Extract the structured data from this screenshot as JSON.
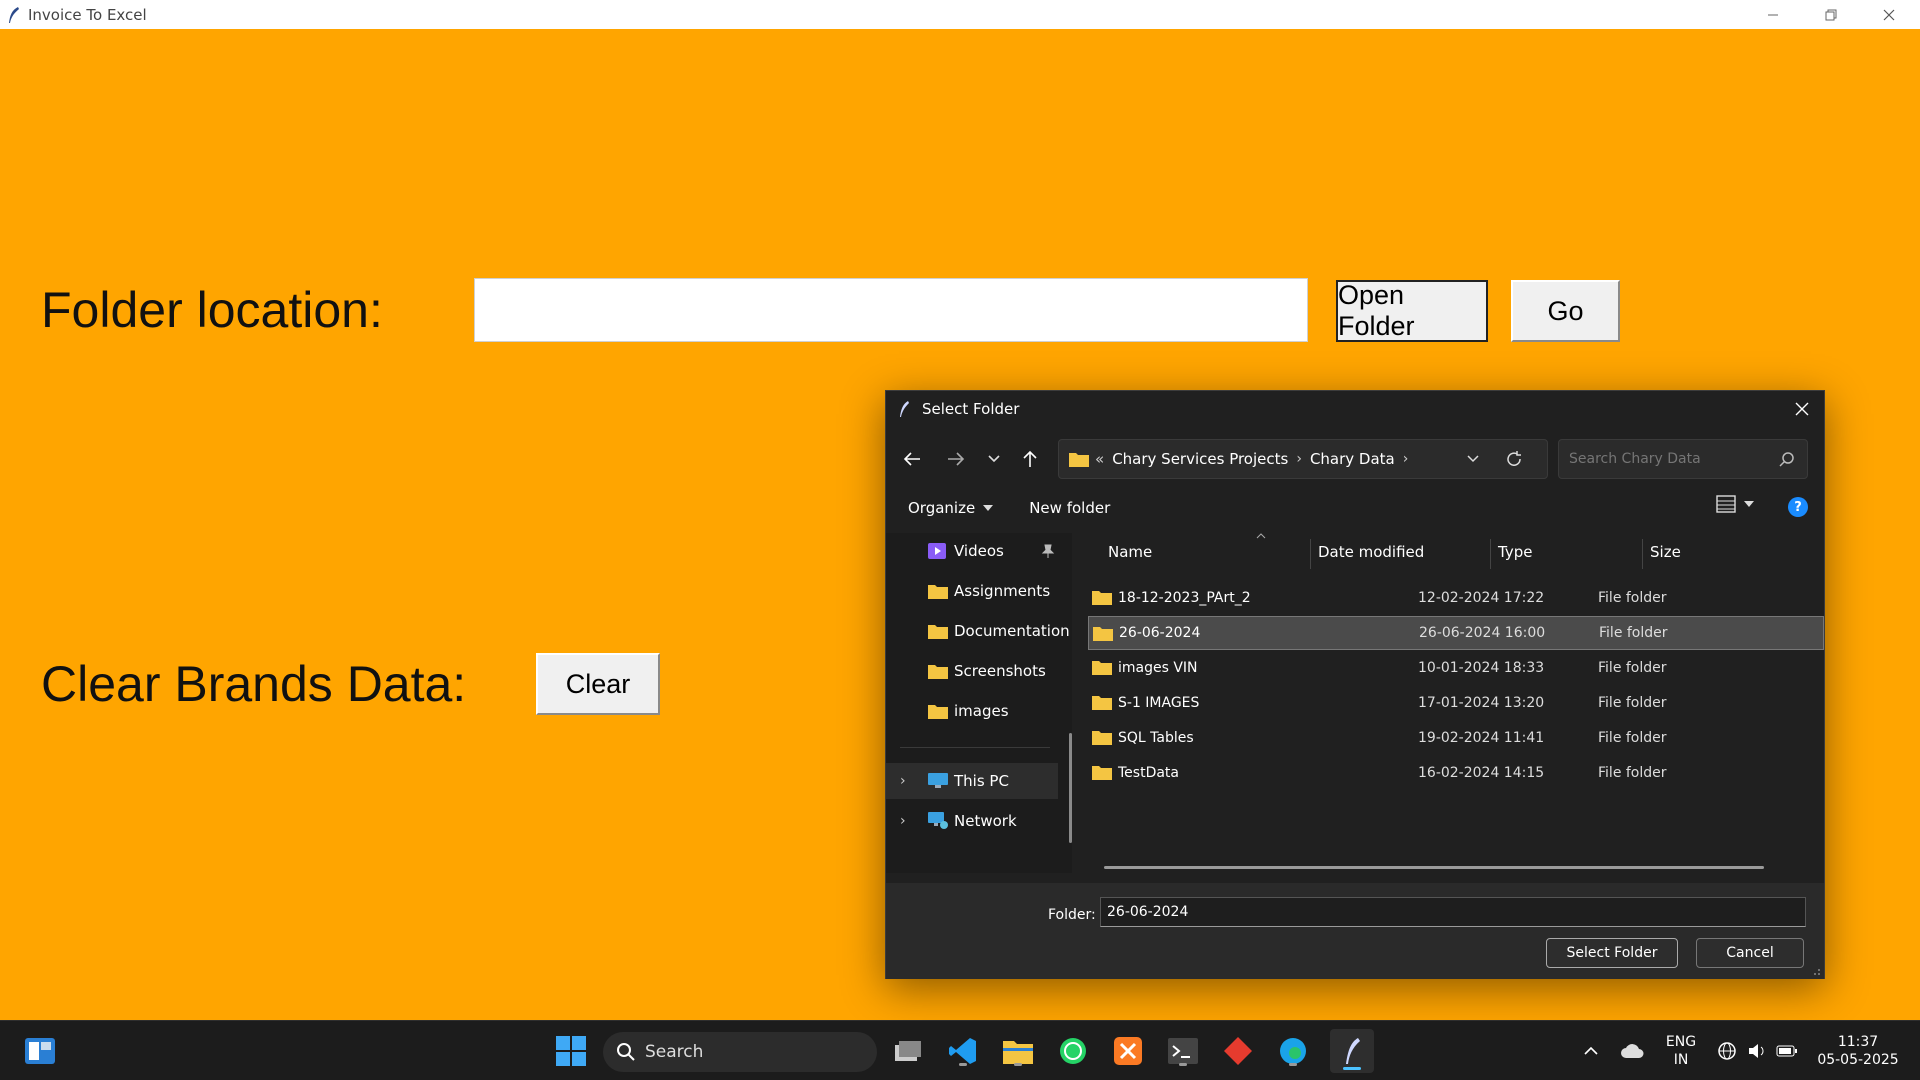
{
  "window": {
    "title": "Invoice To Excel"
  },
  "app": {
    "folder_location_label": "Folder location:",
    "folder_path_value": "",
    "open_folder_label": "Open Folder",
    "go_label": "Go",
    "clear_brands_label": "Clear Brands Data:",
    "clear_label": "Clear"
  },
  "dialog": {
    "title": "Select Folder",
    "breadcrumb": [
      "Chary Services Projects",
      "Chary Data"
    ],
    "breadcrumb_overflow": "«",
    "search_placeholder": "Search Chary Data",
    "organize_label": "Organize",
    "new_folder_label": "New folder",
    "nav_items": [
      {
        "label": "Videos",
        "icon": "videos-icon",
        "pinned": true
      },
      {
        "label": "Assignments",
        "icon": "folder-icon"
      },
      {
        "label": "Documentation",
        "icon": "folder-icon"
      },
      {
        "label": "Screenshots",
        "icon": "folder-icon"
      },
      {
        "label": "images",
        "icon": "folder-icon"
      },
      {
        "label": "This PC",
        "icon": "pc-icon",
        "expandable": true
      },
      {
        "label": "Network",
        "icon": "network-icon",
        "expandable": true
      }
    ],
    "columns": {
      "name": "Name",
      "date": "Date modified",
      "type": "Type",
      "size": "Size"
    },
    "files": [
      {
        "name": "18-12-2023_PArt_2",
        "date": "12-02-2024 17:22",
        "type": "File folder"
      },
      {
        "name": "26-06-2024",
        "date": "26-06-2024 16:00",
        "type": "File folder",
        "selected": true
      },
      {
        "name": "images VIN",
        "date": "10-01-2024 18:33",
        "type": "File folder"
      },
      {
        "name": "S-1 IMAGES",
        "date": "17-01-2024 13:20",
        "type": "File folder"
      },
      {
        "name": "SQL Tables",
        "date": "19-02-2024 11:41",
        "type": "File folder"
      },
      {
        "name": "TestData",
        "date": "16-02-2024 14:15",
        "type": "File folder"
      }
    ],
    "folder_label": "Folder:",
    "folder_value": "26-06-2024",
    "select_button": "Select Folder",
    "cancel_button": "Cancel"
  },
  "taskbar": {
    "search_label": "Search",
    "lang_line1": "ENG",
    "lang_line2": "IN",
    "time": "11:37",
    "date": "05-05-2025"
  },
  "colors": {
    "app_bg": "#FFA500",
    "dialog_bg": "#202020",
    "accent": "#4cc2ff"
  }
}
